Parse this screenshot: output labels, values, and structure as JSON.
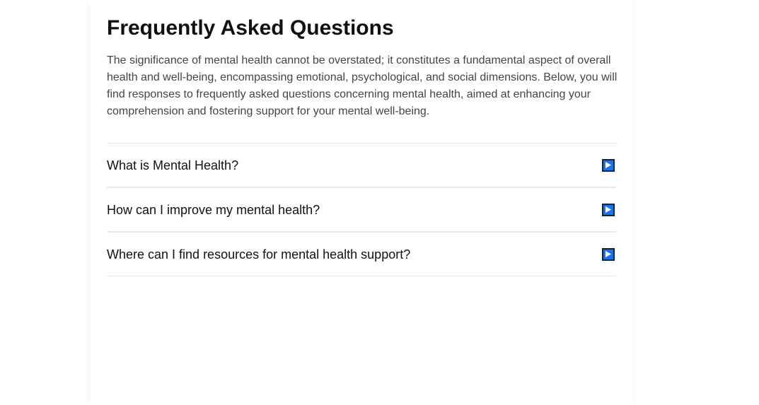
{
  "page": {
    "title": "Frequently Asked Questions",
    "intro": "The significance of mental health cannot be overstated; it constitutes a fundamental aspect of overall health and well-being, encompassing emotional, psychological, and social dimensions. Below, you will find responses to frequently asked questions concerning mental health, aimed at enhancing your comprehension and fostering support for your mental well-being."
  },
  "faq": {
    "items": [
      {
        "question": "What is Mental Health?",
        "icon": "play-triangle-icon"
      },
      {
        "question": "How can I improve my mental health?",
        "icon": "play-triangle-icon"
      },
      {
        "question": "Where can I find resources for mental health support?",
        "icon": "play-triangle-icon"
      }
    ]
  },
  "colors": {
    "accent": "#1a73e8",
    "icon_border": "#0b2540",
    "divider": "#e8e8e8",
    "text": "#111111",
    "muted_text": "#444444"
  }
}
